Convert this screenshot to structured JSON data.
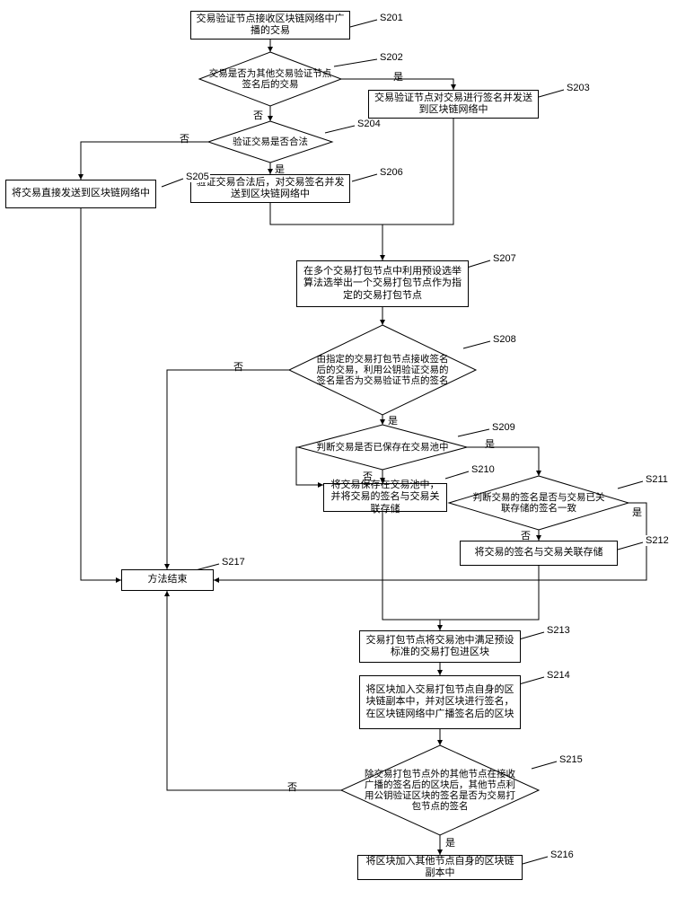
{
  "steps": {
    "s201": {
      "tag": "S201",
      "text": "交易验证节点接收区块链网络中广播的交易"
    },
    "s202": {
      "tag": "S202",
      "text": "交易是否为其他交易验证节点签名后的交易"
    },
    "s203": {
      "tag": "S203",
      "text": "交易验证节点对交易进行签名并发送到区块链网络中"
    },
    "s204": {
      "tag": "S204",
      "text": "验证交易是否合法"
    },
    "s205": {
      "tag": "S205",
      "text": "将交易直接发送到区块链网络中"
    },
    "s206": {
      "tag": "S206",
      "text": "验证交易合法后，对交易签名并发送到区块链网络中"
    },
    "s207": {
      "tag": "S207",
      "text": "在多个交易打包节点中利用预设选举算法选举出一个交易打包节点作为指定的交易打包节点"
    },
    "s208": {
      "tag": "S208",
      "text": "由指定的交易打包节点接收签名后的交易，利用公钥验证交易的签名是否为交易验证节点的签名"
    },
    "s209": {
      "tag": "S209",
      "text": "判断交易是否已保存在交易池中"
    },
    "s210": {
      "tag": "S210",
      "text": "将交易保存在交易池中，并将交易的签名与交易关联存储"
    },
    "s211": {
      "tag": "S211",
      "text": "判断交易的签名是否与交易已关联存储的签名一致"
    },
    "s212": {
      "tag": "S212",
      "text": "将交易的签名与交易关联存储"
    },
    "s213": {
      "tag": "S213",
      "text": "交易打包节点将交易池中满足预设标准的交易打包进区块"
    },
    "s214": {
      "tag": "S214",
      "text": "将区块加入交易打包节点自身的区块链副本中，并对区块进行签名，在区块链网络中广播签名后的区块"
    },
    "s215": {
      "tag": "S215",
      "text": "除交易打包节点外的其他节点在接收广播的签名后的区块后，其他节点利用公钥验证区块的签名是否为交易打包节点的签名"
    },
    "s216": {
      "tag": "S216",
      "text": "将区块加入其他节点自身的区块链副本中"
    },
    "s217": {
      "tag": "S217",
      "text": "方法结束"
    }
  },
  "labels": {
    "yes": "是",
    "no": "否"
  }
}
